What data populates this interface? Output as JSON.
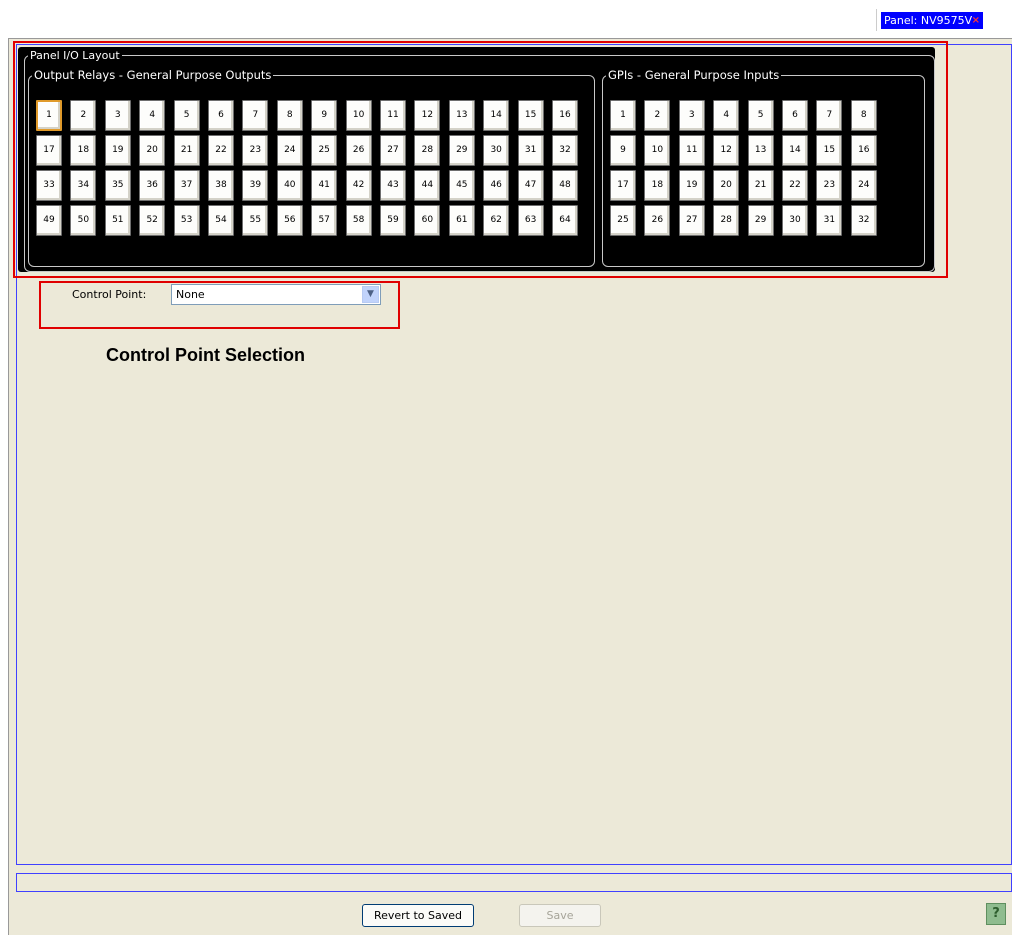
{
  "tab": {
    "label": "Panel: NV9575V",
    "close": "×"
  },
  "panel": {
    "title": "Panel I/O Layout",
    "outputs": {
      "label": "Output Relays - General Purpose Outputs",
      "rows": [
        [
          "1",
          "2",
          "3",
          "4",
          "5",
          "6",
          "7",
          "8",
          "9",
          "10",
          "11",
          "12",
          "13",
          "14",
          "15",
          "16"
        ],
        [
          "17",
          "18",
          "19",
          "20",
          "21",
          "22",
          "23",
          "24",
          "25",
          "26",
          "27",
          "28",
          "29",
          "30",
          "31",
          "32"
        ],
        [
          "33",
          "34",
          "35",
          "36",
          "37",
          "38",
          "39",
          "40",
          "41",
          "42",
          "43",
          "44",
          "45",
          "46",
          "47",
          "48"
        ],
        [
          "49",
          "50",
          "51",
          "52",
          "53",
          "54",
          "55",
          "56",
          "57",
          "58",
          "59",
          "60",
          "61",
          "62",
          "63",
          "64"
        ]
      ],
      "selected": "1"
    },
    "inputs": {
      "label": "GPIs - General Purpose Inputs",
      "rows": [
        [
          "1",
          "2",
          "3",
          "4",
          "5",
          "6",
          "7",
          "8"
        ],
        [
          "9",
          "10",
          "11",
          "12",
          "13",
          "14",
          "15",
          "16"
        ],
        [
          "17",
          "18",
          "19",
          "20",
          "21",
          "22",
          "23",
          "24"
        ],
        [
          "25",
          "26",
          "27",
          "28",
          "29",
          "30",
          "31",
          "32"
        ]
      ]
    }
  },
  "control_point": {
    "label": "Control Point:",
    "value": "None",
    "caption": "Control Point Selection"
  },
  "footer": {
    "revert_label": "Revert to Saved",
    "save_label": "Save",
    "help_label": "?"
  },
  "colors": {
    "annotation": "#e00000",
    "tab_bg": "#0000ff",
    "panel_bg": "#000000",
    "window_bg": "#ece9d8"
  },
  "icons": {
    "dropdown": "chevron-down-icon",
    "help": "help-icon",
    "close": "close-icon"
  }
}
